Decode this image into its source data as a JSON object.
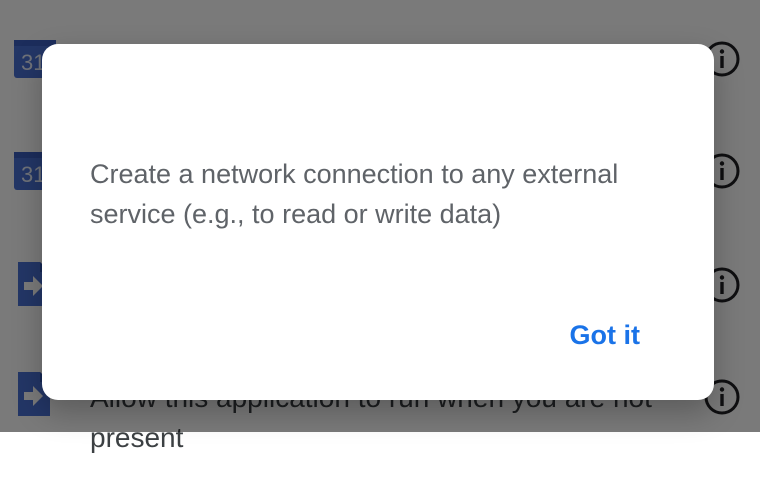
{
  "background_list": {
    "rows": [
      {
        "icon": "calendar-icon",
        "icon_text": "31",
        "label": ""
      },
      {
        "icon": "calendar-icon",
        "icon_text": "31",
        "label": ""
      },
      {
        "icon": "document-arrow-icon",
        "icon_text": "",
        "label": ""
      },
      {
        "icon": "document-arrow-icon",
        "icon_text": "",
        "label": "Allow this application to run when you are not present"
      }
    ]
  },
  "dialog": {
    "message": "Create a network connection to any external service (e.g., to read or write data)",
    "button_label": "Got it"
  },
  "colors": {
    "accent": "#1a73e8",
    "message_text": "#5f6368",
    "calendar_blue": "#4a72d6"
  }
}
